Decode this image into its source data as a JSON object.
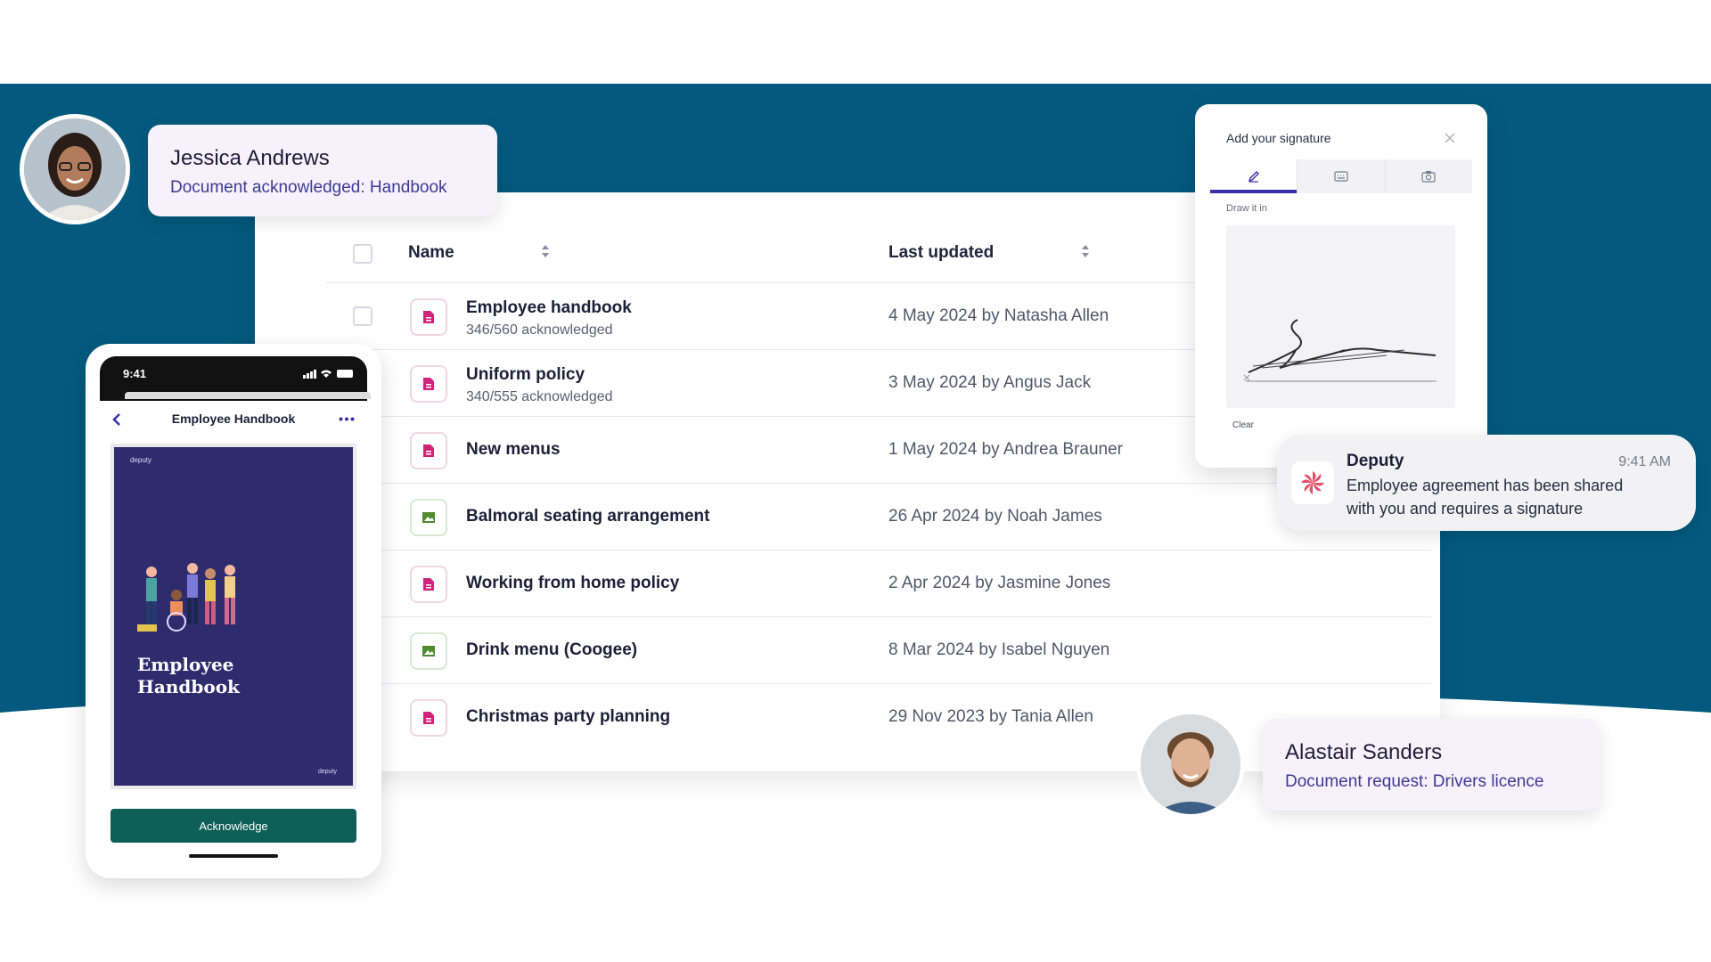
{
  "colors": {
    "brand_band": "#035a7e",
    "accent_purple": "#3e3a95",
    "doc_icon_pink": "#d0237a",
    "image_icon_green": "#4e8a2e",
    "acknowledge_button": "#0e5f55"
  },
  "jessica_toast": {
    "name": "Jessica Andrews",
    "message": "Document acknowledged: Handbook"
  },
  "alastair_toast": {
    "name": "Alastair Sanders",
    "message": "Document request: Drivers licence"
  },
  "table": {
    "columns": {
      "name": "Name",
      "last_updated": "Last updated"
    },
    "rows": [
      {
        "name": "Employee handbook",
        "sub": "346/560 acknowledged",
        "updated": "4 May 2024 by Natasha Allen",
        "icon": "document-icon"
      },
      {
        "name": "Uniform policy",
        "sub": "340/555 acknowledged",
        "updated": "3 May 2024 by Angus Jack",
        "icon": "document-icon"
      },
      {
        "name": "New menus",
        "sub": "",
        "updated": "1 May 2024 by Andrea Brauner",
        "icon": "document-icon"
      },
      {
        "name": "Balmoral seating arrangement",
        "sub": "",
        "updated": "26 Apr 2024 by Noah James",
        "icon": "image-icon"
      },
      {
        "name": "Working from home policy",
        "sub": "",
        "updated": "2 Apr 2024 by Jasmine Jones",
        "icon": "document-icon"
      },
      {
        "name": "Drink menu (Coogee)",
        "sub": "",
        "updated": "8 Mar 2024 by Isabel Nguyen",
        "icon": "image-icon"
      },
      {
        "name": "Christmas party planning",
        "sub": "",
        "updated": "29 Nov 2023 by Tania Allen",
        "icon": "document-icon"
      }
    ]
  },
  "phone": {
    "time": "9:41",
    "title": "Employee Handbook",
    "cover_brand": "deputy",
    "cover_title": "Employee Handbook",
    "acknowledge_label": "Acknowledge"
  },
  "signature": {
    "title": "Add your signature",
    "tabs": [
      "pen-icon",
      "keyboard-icon",
      "camera-icon"
    ],
    "draw_label": "Draw it in",
    "clear_label": "Clear"
  },
  "notification": {
    "app": "Deputy",
    "time": "9:41 AM",
    "message": "Employee agreement has been shared with you and requires a signature"
  }
}
